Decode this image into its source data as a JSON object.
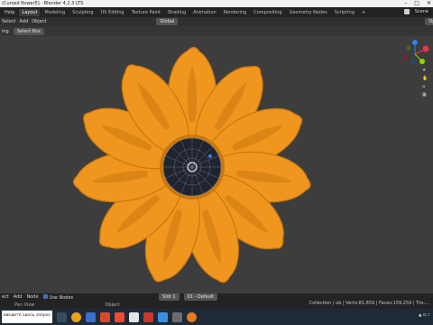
{
  "window": {
    "title": "(Cursed flower5] - Blender 4.2.3 LTS",
    "controls": [
      "–",
      "□",
      "✕"
    ]
  },
  "menubar": {
    "items": [
      "Help"
    ],
    "workspaces": [
      "Layout",
      "Modeling",
      "Sculpting",
      "UV Editing",
      "Texture Paint",
      "Shading",
      "Animation",
      "Rendering",
      "Compositing",
      "Geometry Nodes",
      "Scripting"
    ],
    "active_workspace": "Layout",
    "add_tab": "+",
    "scene_label": "Scene"
  },
  "toolbar": {
    "items": [
      "Select",
      "Add",
      "Object"
    ],
    "orientation": "Global",
    "options": "Options"
  },
  "viewport_header": {
    "mode": "ing",
    "select_mode": "Select Box"
  },
  "gizmo": {
    "axes": [
      "X",
      "Y",
      "Z"
    ],
    "colors": {
      "x": "#e8344b",
      "y": "#8bdc00",
      "z": "#2f83e8"
    }
  },
  "model": {
    "petal_color": "#f0961f",
    "petal_edge": "#c9780c",
    "center_color": "#1f2430",
    "wire_color": "#7a8088"
  },
  "node_bar": {
    "items": [
      "ect",
      "Add",
      "Node"
    ],
    "use_nodes": "Use Nodes",
    "slot": "Slot 1",
    "material": "01 - Default"
  },
  "status": {
    "pan_view": "Pan View",
    "object": "Object",
    "stats": "Collection | ob | Verts:81,859 | Faces:159,259 | Tris:..."
  },
  "taskbar": {
    "search_text": "введите здесь запрос"
  }
}
